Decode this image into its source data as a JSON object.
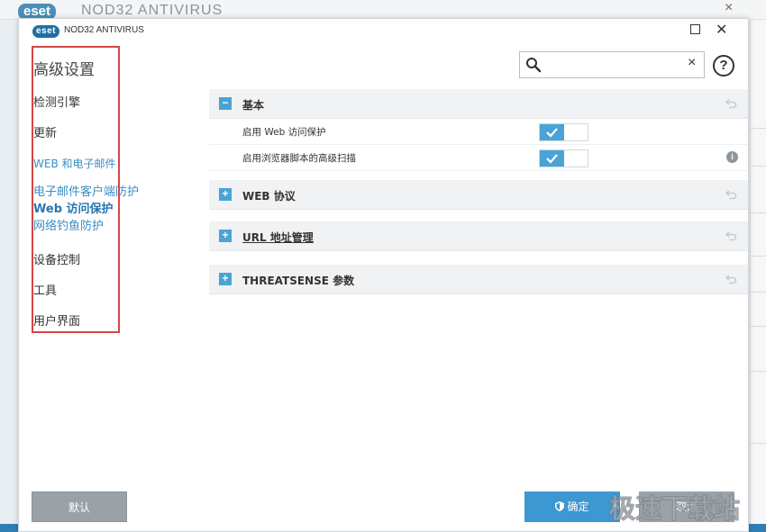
{
  "background_window": {
    "logo": "eset",
    "title": "NOD32 ANTIVIRUS",
    "close": "×"
  },
  "window": {
    "logo": "eset",
    "title": "NOD32 ANTIVIRUS",
    "maximize_icon": "maximize-icon",
    "close_label": "✕"
  },
  "sidebar": {
    "title": "高级设置",
    "items": [
      {
        "label": "检测引擎"
      },
      {
        "label": "更新"
      },
      {
        "label": "WEB 和电子邮件"
      },
      {
        "label": "电子邮件客户端防护"
      },
      {
        "label": "Web 访问保护"
      },
      {
        "label": "网络钓鱼防护"
      },
      {
        "label": "设备控制"
      },
      {
        "label": "工具"
      },
      {
        "label": "用户界面"
      }
    ],
    "highlight_color": "#d64545"
  },
  "search": {
    "placeholder": "",
    "value": "",
    "clear_label": "×"
  },
  "help": {
    "label": "?"
  },
  "sections": [
    {
      "label": "基本",
      "expanded": true,
      "toggle": "−",
      "settings": [
        {
          "label": "启用 Web 访问保护",
          "enabled": true
        },
        {
          "label": "启用浏览器脚本的高级扫描",
          "enabled": true,
          "info_icon": "i"
        }
      ]
    },
    {
      "label": "WEB 协议",
      "expanded": false,
      "toggle": "+"
    },
    {
      "label": "URL 地址管理",
      "expanded": false,
      "toggle": "+"
    },
    {
      "label": "THREATSENSE 参数",
      "expanded": false,
      "toggle": "+"
    }
  ],
  "footer": {
    "default_label": "默认",
    "ok_label": "确定",
    "cancel_label": "取消"
  },
  "watermark": "极速下载站",
  "colors": {
    "accent": "#3d97d1",
    "toggle_on": "#4aa3d6",
    "button_gray": "#9aa2a7"
  }
}
